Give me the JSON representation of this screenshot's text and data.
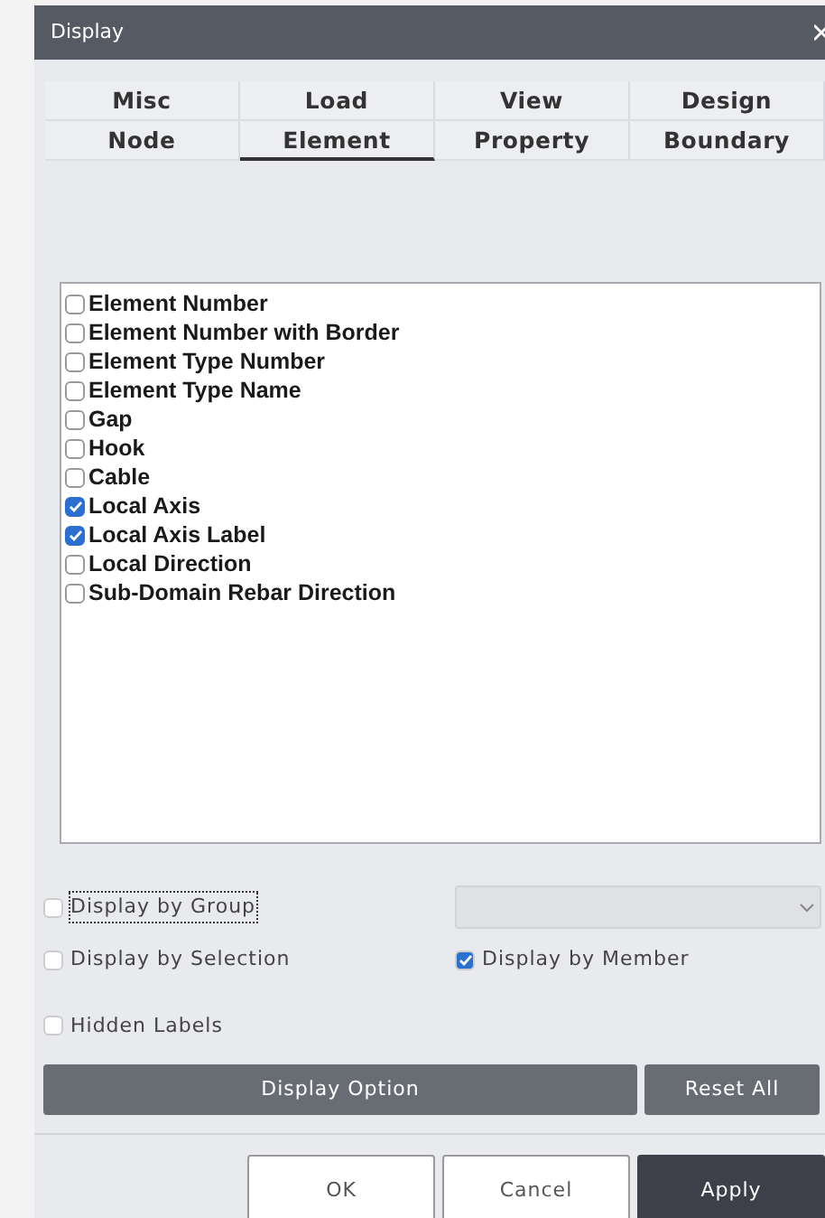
{
  "window": {
    "title": "Display"
  },
  "tab_rows": [
    [
      {
        "label": "Misc",
        "selected": false
      },
      {
        "label": "Load",
        "selected": false
      },
      {
        "label": "View",
        "selected": false
      },
      {
        "label": "Design",
        "selected": false
      }
    ],
    [
      {
        "label": "Node",
        "selected": false
      },
      {
        "label": "Element",
        "selected": true
      },
      {
        "label": "Property",
        "selected": false
      },
      {
        "label": "Boundary",
        "selected": false
      }
    ]
  ],
  "items": [
    {
      "label": "Element Number",
      "checked": false
    },
    {
      "label": "Element Number with Border",
      "checked": false
    },
    {
      "label": "Element Type Number",
      "checked": false
    },
    {
      "label": "Element Type Name",
      "checked": false
    },
    {
      "label": "Gap",
      "checked": false
    },
    {
      "label": "Hook",
      "checked": false
    },
    {
      "label": "Cable",
      "checked": false
    },
    {
      "label": "Local Axis",
      "checked": true
    },
    {
      "label": "Local Axis Label",
      "checked": true
    },
    {
      "label": "Local Direction",
      "checked": false
    },
    {
      "label": "Sub-Domain Rebar Direction",
      "checked": false
    }
  ],
  "options": {
    "display_by_group": {
      "label": "Display by Group",
      "checked": false
    },
    "display_by_selection": {
      "label": "Display by Selection",
      "checked": false
    },
    "display_by_member": {
      "label": "Display by Member",
      "checked": true
    },
    "hidden_labels": {
      "label": "Hidden Labels",
      "checked": false
    }
  },
  "action_buttons": [
    "Display Option",
    "Reset All"
  ],
  "footer_buttons": [
    {
      "label": "OK",
      "kind": "plain"
    },
    {
      "label": "Cancel",
      "kind": "plain"
    },
    {
      "label": "Apply",
      "kind": "primary"
    }
  ]
}
